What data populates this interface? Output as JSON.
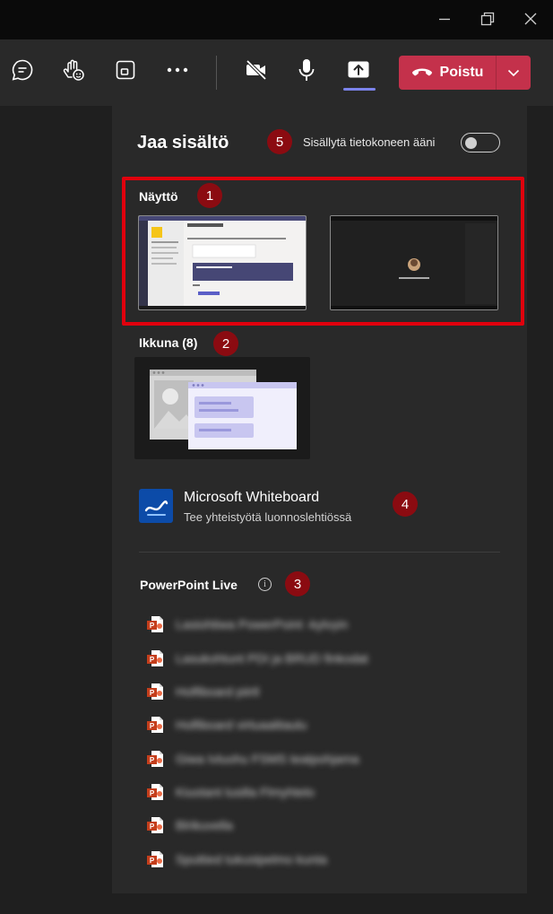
{
  "colors": {
    "accent": "#7b83eb",
    "leave_red": "#c4314b",
    "highlight_red": "#e0000d",
    "badge_red": "#8b0b11",
    "panel_bg": "#292929",
    "whiteboard_blue": "#0c4ba8"
  },
  "titlebar": {
    "icons": [
      "minimize-icon",
      "restore-icon",
      "close-icon"
    ]
  },
  "toolbar": {
    "icons": [
      "chat-icon",
      "raise-hand-icon",
      "room-icon",
      "more-icon",
      "camera-off-icon",
      "mic-icon",
      "share-tray-icon"
    ],
    "leave_label": "Poistu"
  },
  "share_panel": {
    "title": "Jaa sisältö",
    "include_audio_label": "Sisällytä tietokoneen ääni",
    "include_audio_on": false,
    "screen_section": "Näyttö",
    "window_section": "Ikkuna (8)",
    "whiteboard": {
      "title": "Microsoft Whiteboard",
      "subtitle": "Tee yhteistyötä luonnoslehtiössä"
    },
    "powerpoint_section": "PowerPoint Live",
    "info_glyph": "i",
    "powerpoint_files": [
      "Lasiohtiwa PowerPoint -kylvyin",
      "Lasukohtunt PDI ja BRUD finkodat",
      "Holfiboard piirtl",
      "Holfiboard virtuaalitaulu",
      "Giwa Ivluohu FSMS teatpohjama",
      "Kiuotant lusilla Flmyhtelo",
      "Blrikuvella",
      "Sputtied tukustpelmo kunta"
    ]
  },
  "callouts": {
    "screen": "1",
    "window": "2",
    "powerpoint": "3",
    "whiteboard": "4",
    "audio": "5"
  }
}
